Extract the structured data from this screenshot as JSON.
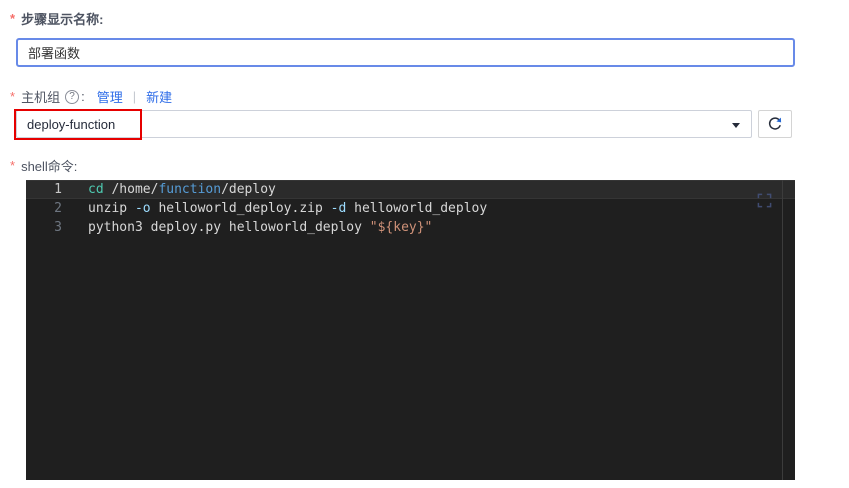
{
  "form": {
    "step_name": {
      "required": "*",
      "label": "步骤显示名称:",
      "value": "部署函数"
    },
    "host_group": {
      "required": "*",
      "label": "主机组",
      "help": "?",
      "colon": ":",
      "manage_link": "管理",
      "divider": "|",
      "new_link": "新建",
      "selected_value": "deploy-function"
    },
    "shell": {
      "required": "*",
      "label": "shell命令:"
    }
  },
  "editor": {
    "active_line": 1,
    "lines": [
      {
        "number": "1",
        "active": true,
        "tokens": [
          [
            "cd",
            "teal"
          ],
          [
            " /home/",
            "plain"
          ],
          [
            "function",
            "blue"
          ],
          [
            "/deploy",
            "plain"
          ]
        ]
      },
      {
        "number": "2",
        "active": false,
        "tokens": [
          [
            "unzip ",
            "plain"
          ],
          [
            "-o",
            "lightblue"
          ],
          [
            " helloworld_deploy.zip ",
            "plain"
          ],
          [
            "-d",
            "lightblue"
          ],
          [
            " helloworld_deploy",
            "plain"
          ]
        ]
      },
      {
        "number": "3",
        "active": false,
        "tokens": [
          [
            "python3 deploy.py helloworld_deploy ",
            "plain"
          ],
          [
            "\"${key}\"",
            "str"
          ]
        ]
      }
    ]
  },
  "colors": {
    "input_focus_border": "#688ae8",
    "annotation_red": "#e60000",
    "required_red": "#f66f6a",
    "link_blue": "#2f6de8",
    "editor_bg": "#1f1f1f",
    "token_teal": "#4ec9b0",
    "token_blue": "#569cd6",
    "token_lightblue": "#9cdcfe",
    "token_string": "#ce9178"
  }
}
